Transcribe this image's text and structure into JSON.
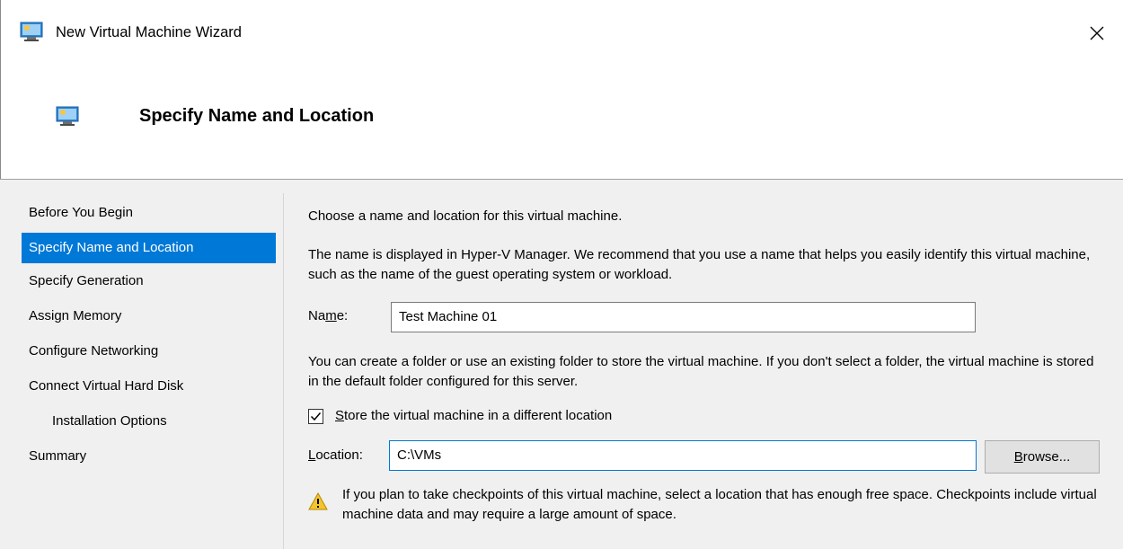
{
  "window": {
    "title": "New Virtual Machine Wizard",
    "close_label": "✕"
  },
  "header": {
    "title": "Specify Name and Location"
  },
  "nav": {
    "items": [
      {
        "label": "Before You Begin"
      },
      {
        "label": "Specify Name and Location"
      },
      {
        "label": "Specify Generation"
      },
      {
        "label": "Assign Memory"
      },
      {
        "label": "Configure Networking"
      },
      {
        "label": "Connect Virtual Hard Disk"
      },
      {
        "label": "Installation Options"
      },
      {
        "label": "Summary"
      }
    ]
  },
  "main": {
    "intro": "Choose a name and location for this virtual machine.",
    "name_help": "The name is displayed in Hyper-V Manager. We recommend that you use a name that helps you easily identify this virtual machine, such as the name of the guest operating system or workload.",
    "name_label_pre": "Na",
    "name_label_acc": "m",
    "name_label_post": "e:",
    "name_value": "Test Machine 01",
    "folder_help": "You can create a folder or use an existing folder to store the virtual machine. If you don't select a folder, the virtual machine is stored in the default folder configured for this server.",
    "store_checkbox_checked": true,
    "store_label_acc": "S",
    "store_label_rest": "tore the virtual machine in a different location",
    "location_label_acc": "L",
    "location_label_rest": "ocation:",
    "location_value": "C:\\VMs",
    "browse_label_acc": "B",
    "browse_label_rest": "rowse...",
    "warning": "If you plan to take checkpoints of this virtual machine, select a location that has enough free space. Checkpoints include virtual machine data and may require a large amount of space."
  },
  "colors": {
    "selection": "#0078d7",
    "content_bg": "#f0f0f0",
    "warning": "#f4c430"
  }
}
